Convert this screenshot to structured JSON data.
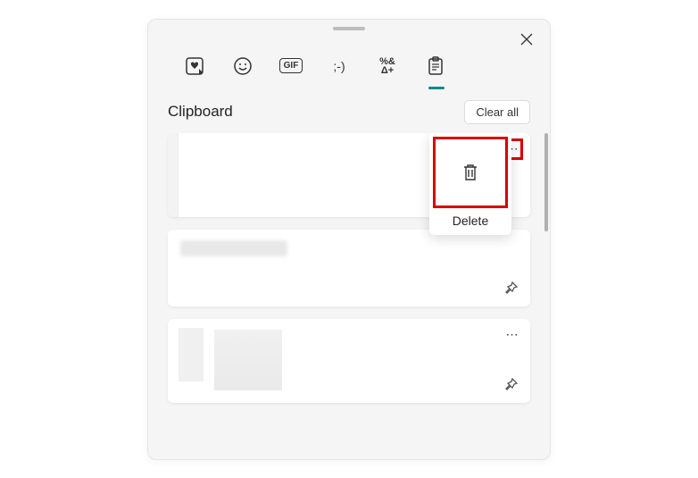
{
  "header": {
    "title": "Clipboard",
    "clear_all": "Clear all"
  },
  "tabs": {
    "gif_label": "GIF",
    "kaomoji_label": ";-)",
    "symbols_label": "%&\nΔ+"
  },
  "popup": {
    "delete_label": "Delete"
  },
  "icons": {
    "more": "⋯"
  }
}
